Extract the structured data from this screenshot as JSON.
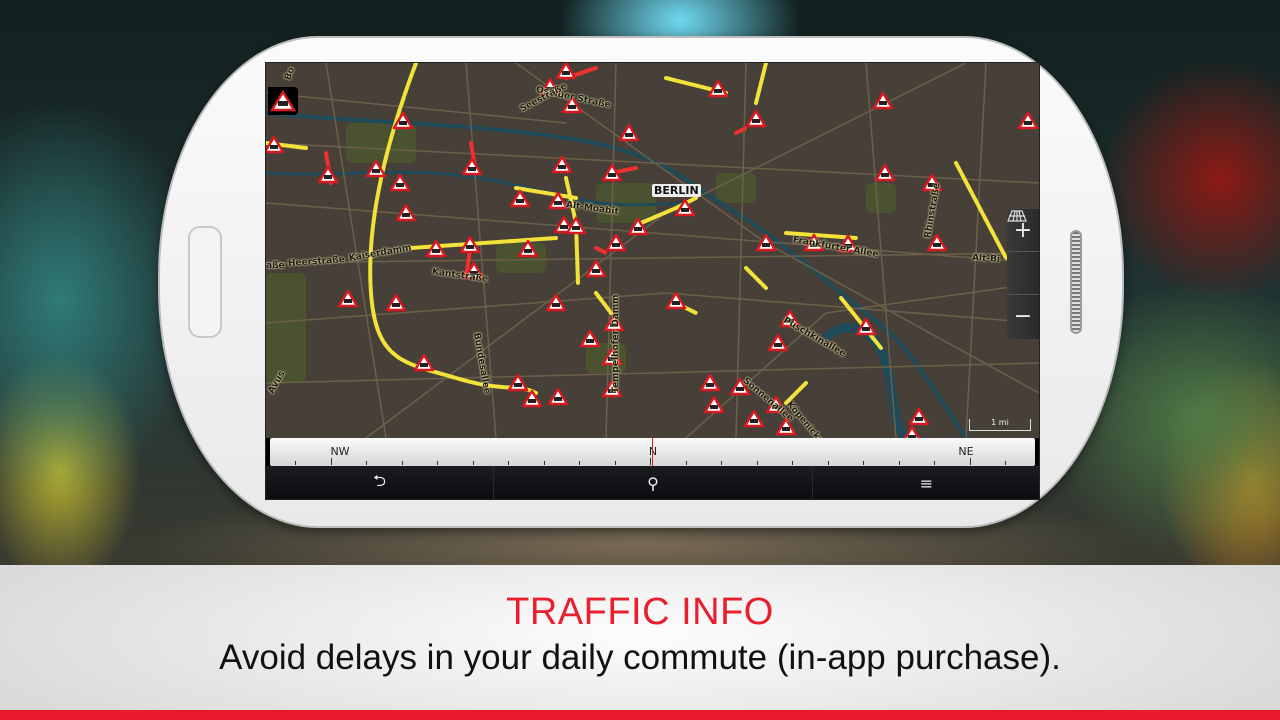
{
  "map": {
    "city_label": "BERLIN",
    "street_labels": [
      "Oslauer Straße",
      "Seestraße",
      "Alt-Moabit",
      "Kaiserdamm",
      "Heerstraße",
      "Kantstraße",
      "Frankfurter Allee",
      "Rhinstraße",
      "Alt-Bi",
      "Puschkinallee",
      "Sonnenallee",
      "Köpenicker Landstraße",
      "Tempelhofer Damm",
      "Bundesallee",
      "Avus",
      "Bo",
      "aße"
    ],
    "scale_label": "1 mi",
    "alert_icon": "traffic-jam-warning-icon",
    "colors": {
      "traffic_slow": "#f2e23a",
      "traffic_stopped": "#ee3030",
      "warning_border": "#d71920"
    }
  },
  "zoom_controls": {
    "zoom_in": "+",
    "view_toggle_icon": "grid-perspective-icon",
    "zoom_out": "−"
  },
  "compass": {
    "labels": [
      "NW",
      "N",
      "NE"
    ]
  },
  "bottom_bar": {
    "back_icon": "back-arrow-icon",
    "back": "⮌",
    "search_icon": "search-icon",
    "search": "⚲",
    "menu_icon": "menu-icon",
    "menu": "≡"
  },
  "caption": {
    "title": "TRAFFIC INFO",
    "subtitle": "Avoid delays in your daily commute (in-app purchase)."
  },
  "accent_color": "#e8192c"
}
